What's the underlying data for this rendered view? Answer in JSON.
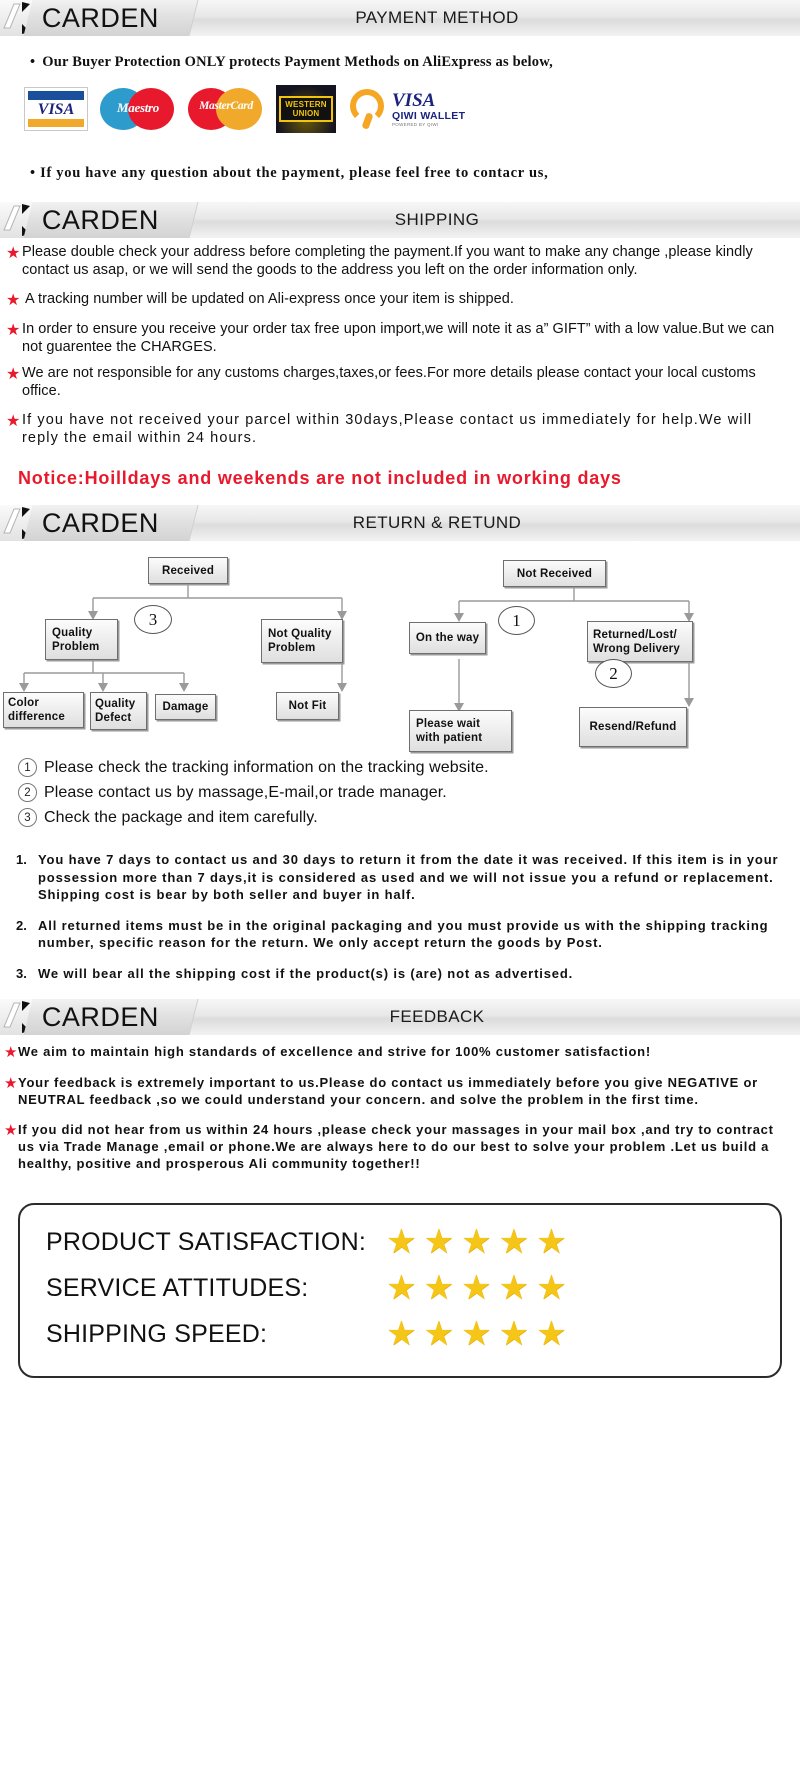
{
  "brand": "CARDEN",
  "sections": [
    {
      "id": "payment",
      "title": "PAYMENT METHOD"
    },
    {
      "id": "shipping",
      "title": "SHIPPING"
    },
    {
      "id": "return",
      "title": "RETURN & RETUND"
    },
    {
      "id": "feedback",
      "title": "FEEDBACK"
    }
  ],
  "payment": {
    "bullet_top": "Our Buyer Protection ONLY protects Payment Methods on AliExpress as below,",
    "bullet_bottom": "If you have any question about the payment, please feel free to contacr us,",
    "logos": [
      {
        "name": "visa-logo",
        "label": "VISA"
      },
      {
        "name": "maestro-logo",
        "label": "Maestro"
      },
      {
        "name": "mastercard-logo",
        "label": "MasterCard"
      },
      {
        "name": "western-union-logo",
        "label_line1": "WESTERN",
        "label_line2": "UNION"
      },
      {
        "name": "qiwi-wallet-logo",
        "label": "VISA",
        "sub": "QIWI WALLET",
        "powered": "POWERED BY QIWI"
      }
    ]
  },
  "shipping": {
    "items": [
      "Please double check your address before completing the payment.If you want to make any change ,please kindly contact us asap, or we will send the goods to the address you left on the order information only.",
      "A tracking number will be updated on Ali-express once your item is shipped.",
      "In order to ensure you receive your order tax free upon import,we will note it as a” GIFT” with a low value.But we can not guarentee the CHARGES.",
      "We are not responsible for any customs charges,taxes,or fees.For more details please contact your local customs office.",
      "If you have not received your parcel within 30days,Please contact us immediately for help.We will reply the email within 24 hours."
    ],
    "notice": "Notice:Hoilldays and weekends are not included in working days"
  },
  "flowchart": {
    "boxes": {
      "received": "Received",
      "quality_problem": "Quality\nProblem",
      "not_quality_problem": "Not Quality\nProblem",
      "color_difference": "Color\ndifference",
      "quality_defect": "Quality\nDefect",
      "damage": "Damage",
      "not_fit": "Not Fit",
      "not_received": "Not  Received",
      "on_the_way": "On the way",
      "returned_lost": "Returned/Lost/\nWrong Delivery",
      "please_wait": "Please wait\nwith patient",
      "resend_refund": "Resend/Refund"
    },
    "markers": {
      "m1": "1",
      "m2": "2",
      "m3": "3"
    }
  },
  "return_notes": {
    "circled": [
      {
        "num": "1",
        "text": "Please check the tracking information on the tracking website."
      },
      {
        "num": "2",
        "text": "Please contact us by  massage,E-mail,or trade manager."
      },
      {
        "num": "3",
        "text": "Check the package and item carefully."
      }
    ],
    "numbered": [
      {
        "num": "1.",
        "text": "You have 7 days to contact us and 30 days to return it from the date it was received. If this item is in your possession more than 7 days,it is considered as used and we will not issue you a refund or replacement. Shipping cost is bear by both seller and buyer in half."
      },
      {
        "num": "2.",
        "text": "All returned items must be in the original packaging and you must provide us with the shipping tracking number, specific reason for the return. We only accept return the goods by Post."
      },
      {
        "num": "3.",
        "text": "We will bear all the shipping cost if the product(s) is (are) not as advertised."
      }
    ]
  },
  "feedback": {
    "items": [
      "We aim to maintain high standards of excellence and strive  for 100% customer satisfaction!",
      "Your feedback is extremely important to us.Please do contact us immediately before you give NEGATIVE or NEUTRAL feedback ,so  we could understand your concern. and solve the problem in the first time.",
      "If you did not hear from us within 24 hours ,please check your massages in your mail box ,and try to contract us via Trade Manage ,email or phone.We are always here to do our best to solve your problem .Let us build a healthy, positive and prosperous Ali community together!!"
    ]
  },
  "rating": {
    "rows": [
      {
        "label": "PRODUCT SATISFACTION:",
        "stars": 5
      },
      {
        "label": "SERVICE  ATTITUDES:",
        "stars": 5
      },
      {
        "label": "SHIPPING SPEED:",
        "stars": 5
      }
    ],
    "star_glyph": "★",
    "star_color": "#f5c518"
  },
  "colors": {
    "accent_red": "#e8192c",
    "banner_grey": "#e4e4e4",
    "text": "#111111"
  }
}
